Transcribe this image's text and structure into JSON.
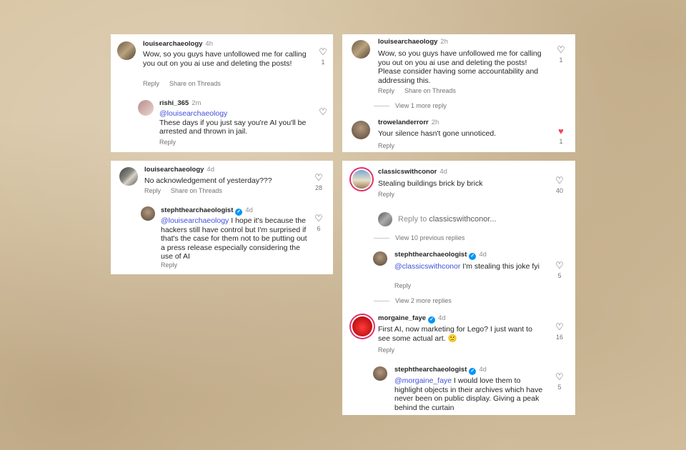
{
  "card1": {
    "main": {
      "user": "louisearchaeology",
      "time": "4h",
      "text": "Wow, so you guys have unfollowed me for calling you out on you ai use and deleting the posts!",
      "actions": [
        "Reply",
        "Share on Threads"
      ],
      "likes": "1"
    },
    "reply": {
      "user": "rishi_365",
      "time": "2m",
      "mention": "@louisearchaeology",
      "text": "These days if you just say you're  AI you'll be arrested and thrown in jail.",
      "action": "Reply"
    }
  },
  "card2": {
    "main": {
      "user": "louisearchaeology",
      "time": "2h",
      "text": "Wow, so you guys have unfollowed me for calling you out on you ai use and deleting the posts! Please consider having some accountability and addressing this.",
      "actions": [
        "Reply",
        "Share on Threads"
      ],
      "likes": "1"
    },
    "view_more": "View 1 more reply",
    "reply": {
      "user": "trowelanderrorr",
      "time": "2h",
      "text": "Your silence hasn't gone unnoticed.",
      "action": "Reply",
      "likes": "1",
      "liked_color": "#ed4956"
    }
  },
  "card3": {
    "main": {
      "user": "louisearchaeology",
      "time": "4d",
      "text": "No acknowledgement of yesterday???",
      "actions": [
        "Reply",
        "Share on Threads"
      ],
      "likes": "28"
    },
    "reply": {
      "user": "stephthearchaeologist",
      "time": "4d",
      "mention": "@louisearchaeology",
      "text": " I hope it's because the hackers still have control but I'm surprised if that's the case for them not to be putting out a press release especially considering the use of AI",
      "action": "Reply",
      "likes": "6"
    }
  },
  "card4": {
    "main": {
      "user": "classicswithconor",
      "time": "4d",
      "text": "Stealing buildings brick by brick",
      "action": "Reply",
      "likes": "40"
    },
    "reply_placeholder": "Reply to ",
    "reply_target": "classicswithconor...",
    "view_previous": "View 10 previous replies",
    "reply1": {
      "user": "stephthearchaeologist",
      "time": "4d",
      "mention": "@classicswithconor",
      "text": " I'm stealing this joke fyi",
      "action": "Reply",
      "likes": "5"
    },
    "view_more": "View 2 more replies",
    "comment2": {
      "user": "morgaine_faye",
      "time": "4d",
      "text": "First AI, now marketing for Lego? I just want to see some actual art. 🙁",
      "action": "Reply",
      "likes": "16"
    },
    "reply2": {
      "user": "stephthearchaeologist",
      "time": "4d",
      "mention": "@morgaine_faye",
      "text": " I would love them to highlight objects in their archives which have never been on public display. Giving a peak behind the curtain",
      "likes": "5"
    }
  },
  "colors": {
    "mention": "#3f51d8",
    "verified": "#0095f6",
    "liked": "#ed4956"
  },
  "icons": {
    "like": "heart-outline-icon",
    "liked": "heart-filled-icon",
    "verified": "verified-badge-icon"
  }
}
